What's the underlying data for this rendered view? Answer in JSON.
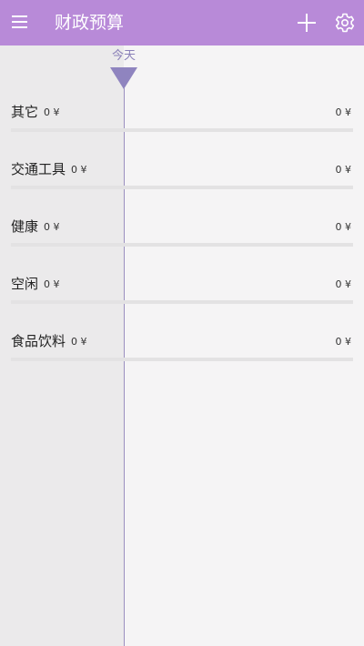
{
  "appbar": {
    "title": "财政预算",
    "background": "#b88ad8",
    "menu_icon": "hamburger-menu-icon",
    "add_icon": "plus-icon",
    "settings_icon": "gear-icon"
  },
  "timeline": {
    "today_label": "今天",
    "marker_color": "#8f84bf"
  },
  "categories": [
    {
      "name": "其它",
      "budget": "0 ¥",
      "spent": "0 ¥",
      "progress": 0
    },
    {
      "name": "交通工具",
      "budget": "0 ¥",
      "spent": "0 ¥",
      "progress": 0
    },
    {
      "name": "健康",
      "budget": "0 ¥",
      "spent": "0 ¥",
      "progress": 0
    },
    {
      "name": "空闲",
      "budget": "0 ¥",
      "spent": "0 ¥",
      "progress": 0
    },
    {
      "name": "食品饮料",
      "budget": "0 ¥",
      "spent": "0 ¥",
      "progress": 0
    }
  ]
}
